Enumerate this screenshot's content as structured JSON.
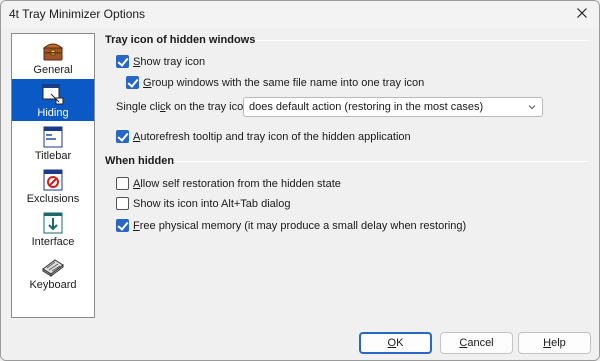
{
  "window": {
    "title": "4t Tray Minimizer Options"
  },
  "sidebar": {
    "items": [
      {
        "label": "General",
        "icon": "treasure-chest-icon",
        "active": false
      },
      {
        "label": "Hiding",
        "icon": "window-hide-icon",
        "active": true
      },
      {
        "label": "Titlebar",
        "icon": "titlebar-icon",
        "active": false
      },
      {
        "label": "Exclusions",
        "icon": "prohibited-window-icon",
        "active": false
      },
      {
        "label": "Interface",
        "icon": "interface-arrow-icon",
        "active": false
      },
      {
        "label": "Keyboard",
        "icon": "keyboard-icon",
        "active": false
      }
    ]
  },
  "tray_group": {
    "title": "Tray icon of hidden windows",
    "show_tray_icon": {
      "label_accel": "S",
      "label_rest": "how tray icon",
      "checked": true
    },
    "group_windows": {
      "label_accel": "G",
      "label_rest": "roup windows with the same file name into one tray icon",
      "checked": true
    },
    "single_click": {
      "label_pre": "Single cli",
      "label_accel": "c",
      "label_post": "k on the tray icon:",
      "value": "does default action (restoring in the most cases)"
    },
    "autorefresh": {
      "label_accel": "A",
      "label_rest": "utorefresh tooltip and tray icon of the hidden application",
      "checked": true
    }
  },
  "hidden_group": {
    "title": "When hidden",
    "allow_self": {
      "label_accel": "A",
      "label_rest": "llow self restoration from the hidden state",
      "checked": false
    },
    "show_alttab": {
      "label": "Show its icon into Alt+Tab dialog",
      "checked": false
    },
    "free_memory": {
      "label_accel": "F",
      "label_rest": "ree physical memory (it may produce a small delay when restoring)",
      "checked": true
    }
  },
  "buttons": {
    "ok": {
      "accel": "O",
      "rest": "K"
    },
    "cancel": {
      "accel": "C",
      "rest": "ancel"
    },
    "help": {
      "accel": "H",
      "rest": "elp"
    }
  },
  "colors": {
    "accent": "#2867c5",
    "sidebar_active": "#0a59c4"
  }
}
